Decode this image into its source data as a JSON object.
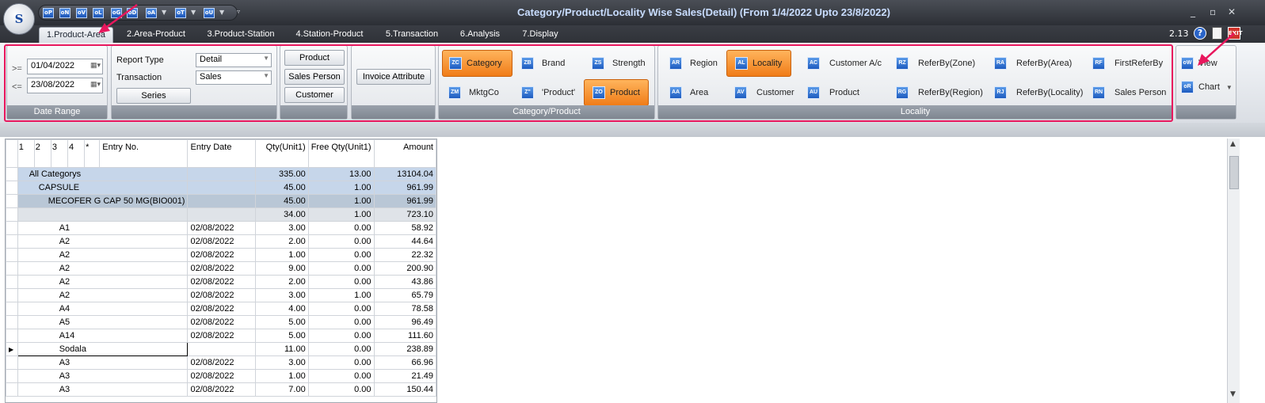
{
  "app": {
    "logo_text": "S",
    "title": "Category/Product/Locality Wise Sales(Detail) (From 1/4/2022 Upto 23/8/2022)",
    "version": "2.13",
    "quick_buttons": [
      "oP",
      "oN",
      "oV",
      "oL",
      "oG",
      "oD",
      "oA",
      "oT",
      "oU"
    ],
    "window_controls": {
      "minimize": "_",
      "restore": "▫",
      "close": "✕"
    }
  },
  "tabs": [
    "1.Product-Area",
    "2.Area-Product",
    "3.Product-Station",
    "4.Station-Product",
    "5.Transaction",
    "6.Analysis",
    "7.Display"
  ],
  "ribbon": {
    "date_range": {
      "label": "Date Range",
      "from_op": ">=",
      "from": "01/04/2022",
      "to_op": "<=",
      "to": "23/08/2022"
    },
    "report": {
      "report_type_label": "Report Type",
      "report_type": "Detail",
      "transaction_label": "Transaction",
      "transaction": "Sales",
      "series_button": "Series"
    },
    "filters": [
      "Product",
      "Sales Person",
      "Customer"
    ],
    "invoice_attribute": "Invoice Attribute",
    "category_product": {
      "label": "Category/Product",
      "items": [
        {
          "label": "Category",
          "icon": "ZC",
          "selected": true
        },
        {
          "label": "Brand",
          "icon": "ZB",
          "selected": false
        },
        {
          "label": "Strength",
          "icon": "ZS",
          "selected": false
        },
        {
          "label": "MktgCo",
          "icon": "ZM",
          "selected": false
        },
        {
          "label": "'Product'",
          "icon": "Z\"",
          "selected": false
        },
        {
          "label": "Product",
          "icon": "ZO",
          "selected": true
        }
      ]
    },
    "locality": {
      "label": "Locality",
      "items": [
        {
          "label": "Region",
          "icon": "AR",
          "selected": false
        },
        {
          "label": "Locality",
          "icon": "AL",
          "selected": true
        },
        {
          "label": "Customer A/c",
          "icon": "AC",
          "selected": false
        },
        {
          "label": "ReferBy(Zone)",
          "icon": "RZ",
          "selected": false
        },
        {
          "label": "ReferBy(Area)",
          "icon": "RA",
          "selected": false
        },
        {
          "label": "FirstReferBy",
          "icon": "RF",
          "selected": false
        },
        {
          "label": "Area",
          "icon": "AA",
          "selected": false
        },
        {
          "label": "Customer",
          "icon": "AV",
          "selected": false
        },
        {
          "label": "Product",
          "icon": "AU",
          "selected": false
        },
        {
          "label": "ReferBy(Region)",
          "icon": "RG",
          "selected": false
        },
        {
          "label": "ReferBy(Locality)",
          "icon": "RJ",
          "selected": false
        },
        {
          "label": "Sales Person",
          "icon": "RN",
          "selected": false
        }
      ]
    },
    "actions": {
      "view": "View",
      "chart": "Chart",
      "view_icon": "oW",
      "chart_icon": "oR"
    }
  },
  "grid": {
    "headers": [
      "1",
      "2",
      "3",
      "4",
      "*",
      "Entry No.",
      "Entry Date",
      "Qty(Unit1)",
      "Free Qty(Unit1)",
      "Amount"
    ],
    "rows": [
      {
        "type": "cat",
        "label": "All Categorys",
        "date": "",
        "qty": "335.00",
        "free": "13.00",
        "amount": "13104.04"
      },
      {
        "type": "sub",
        "label": "CAPSULE",
        "date": "",
        "qty": "45.00",
        "free": "1.00",
        "amount": "961.99"
      },
      {
        "type": "prod",
        "label": "MECOFER G CAP 50 MG(BIO001)",
        "date": "",
        "qty": "45.00",
        "free": "1.00",
        "amount": "961.99"
      },
      {
        "type": "sum",
        "label": "",
        "date": "",
        "qty": "34.00",
        "free": "1.00",
        "amount": "723.10"
      },
      {
        "type": "row",
        "label": "A1",
        "date": "02/08/2022",
        "qty": "3.00",
        "free": "0.00",
        "amount": "58.92"
      },
      {
        "type": "row",
        "label": "A2",
        "date": "02/08/2022",
        "qty": "2.00",
        "free": "0.00",
        "amount": "44.64"
      },
      {
        "type": "row",
        "label": "A2",
        "date": "02/08/2022",
        "qty": "1.00",
        "free": "0.00",
        "amount": "22.32"
      },
      {
        "type": "row",
        "label": "A2",
        "date": "02/08/2022",
        "qty": "9.00",
        "free": "0.00",
        "amount": "200.90"
      },
      {
        "type": "row",
        "label": "A2",
        "date": "02/08/2022",
        "qty": "2.00",
        "free": "0.00",
        "amount": "43.86"
      },
      {
        "type": "row",
        "label": "A2",
        "date": "02/08/2022",
        "qty": "3.00",
        "free": "1.00",
        "amount": "65.79"
      },
      {
        "type": "row",
        "label": "A4",
        "date": "02/08/2022",
        "qty": "4.00",
        "free": "0.00",
        "amount": "78.58"
      },
      {
        "type": "row",
        "label": "A5",
        "date": "02/08/2022",
        "qty": "5.00",
        "free": "0.00",
        "amount": "96.49"
      },
      {
        "type": "row",
        "label": "A14",
        "date": "02/08/2022",
        "qty": "5.00",
        "free": "0.00",
        "amount": "111.60"
      },
      {
        "type": "cur",
        "label": "Sodala",
        "date": "",
        "qty": "11.00",
        "free": "0.00",
        "amount": "238.89"
      },
      {
        "type": "row",
        "label": "A3",
        "date": "02/08/2022",
        "qty": "3.00",
        "free": "0.00",
        "amount": "66.96"
      },
      {
        "type": "row",
        "label": "A3",
        "date": "02/08/2022",
        "qty": "1.00",
        "free": "0.00",
        "amount": "21.49"
      },
      {
        "type": "row",
        "label": "A3",
        "date": "02/08/2022",
        "qty": "7.00",
        "free": "0.00",
        "amount": "150.44"
      }
    ]
  }
}
